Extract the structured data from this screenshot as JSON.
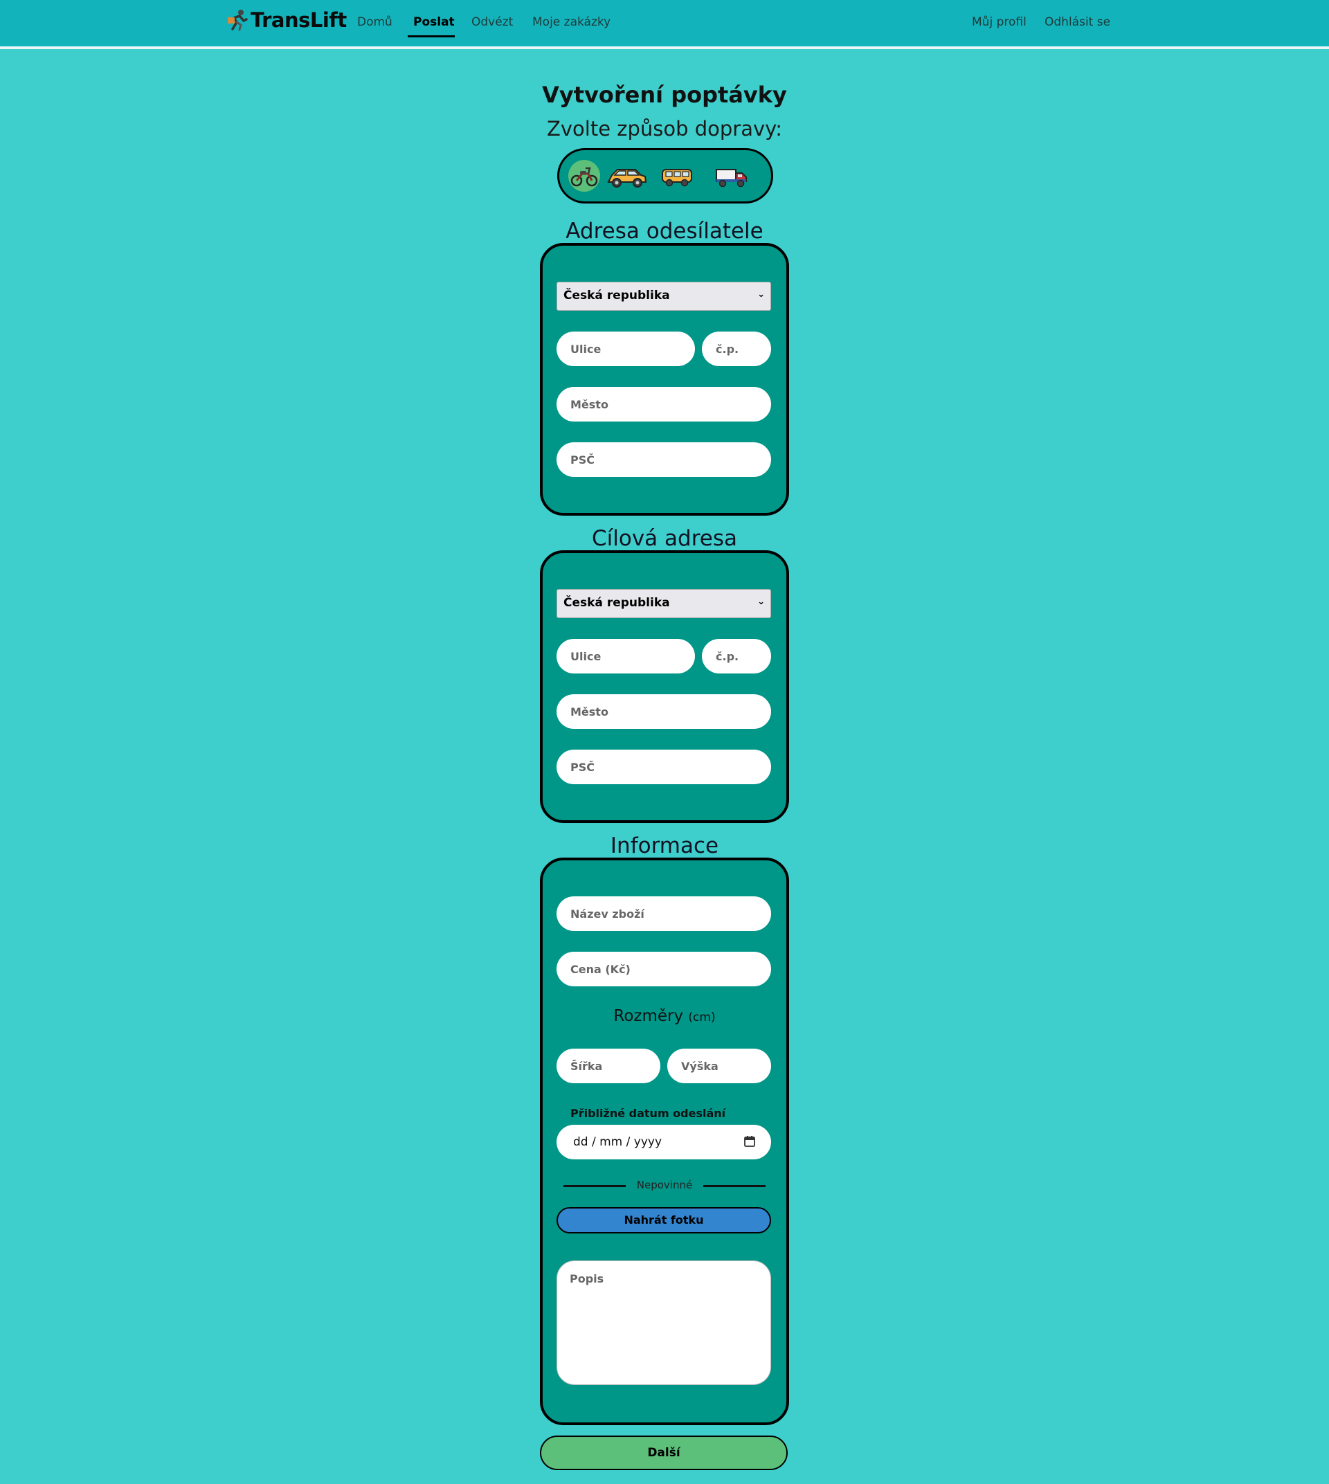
{
  "nav": {
    "brand": "TransLift",
    "links": [
      "Domů",
      "Poslat",
      "Odvézt",
      "Moje zakázky"
    ],
    "active": "Poslat",
    "profile": "Můj profil",
    "logout": "Odhlásit se"
  },
  "page": {
    "title": "Vytvoření poptávky",
    "subtitle": "Zvolte způsob dopravy:"
  },
  "transport": {
    "options": [
      "motorcycle-icon",
      "car-icon",
      "van-icon",
      "truck-icon"
    ],
    "selected": "motorcycle-icon"
  },
  "sender": {
    "title": "Adresa odesílatele",
    "country": "Česká republika",
    "street_placeholder": "Ulice",
    "number_placeholder": "č.p.",
    "city_placeholder": "Město",
    "zip_placeholder": "PSČ"
  },
  "destination": {
    "title": "Cílová adresa",
    "country": "Česká republika",
    "street_placeholder": "Ulice",
    "number_placeholder": "č.p.",
    "city_placeholder": "Město",
    "zip_placeholder": "PSČ"
  },
  "info": {
    "title": "Informace",
    "name_placeholder": "Název zboží",
    "price_placeholder": "Cena (Kč)",
    "dimensions_title": "Rozměry",
    "dimensions_unit": "(cm)",
    "width_placeholder": "Šířka",
    "height_placeholder": "Výška",
    "date_label": "Přibližné datum odeslání",
    "date_value": "dd / mm / yyyy",
    "optional_label": "Nepovinné",
    "upload_label": "Nahrát fotku",
    "description_placeholder": "Popis"
  },
  "next_label": "Další",
  "colors": {
    "background": "#3ecfcc",
    "navbar": "#13b3bb",
    "card": "#009688",
    "selected": "#5cc07a",
    "upload": "#3385d0",
    "next": "#5cc07a"
  }
}
